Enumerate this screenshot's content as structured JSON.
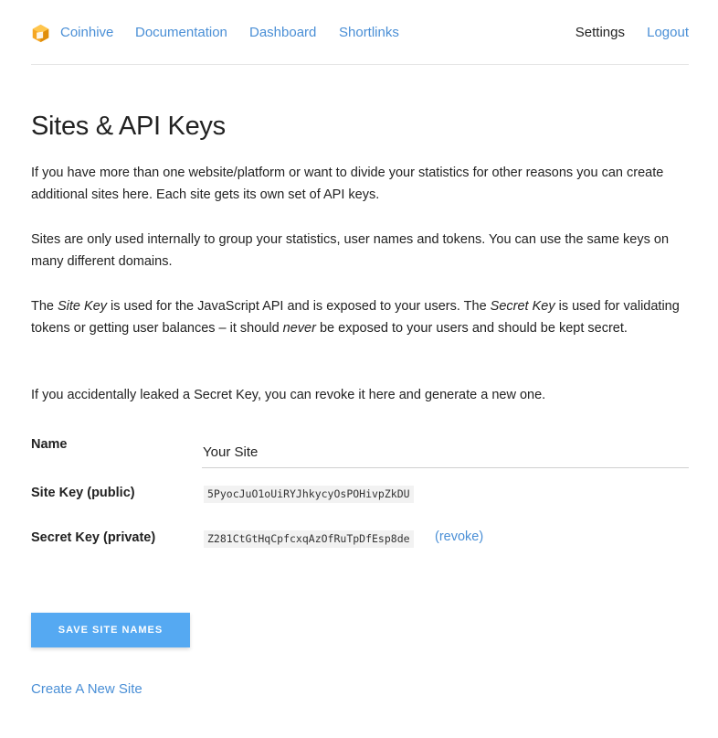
{
  "nav": {
    "logo_icon": "cube-logo-icon",
    "brand": "Coinhive",
    "links": [
      "Documentation",
      "Dashboard",
      "Shortlinks"
    ],
    "settings": "Settings",
    "logout": "Logout"
  },
  "page": {
    "title": "Sites & API Keys",
    "intro1": "If you have more than one website/platform or want to divide your statistics for other reasons you can create additional sites here. Each site gets its own set of API keys.",
    "intro2": "Sites are only used internally to group your statistics, user names and tokens. You can use the same keys on many different domains.",
    "intro3": {
      "a": "The ",
      "site_key": "Site Key",
      "b": " is used for the JavaScript API and is exposed to your users. The ",
      "secret_key": "Secret Key",
      "c": " is used for validating tokens or getting user balances – it should ",
      "never": "never",
      "d": " be exposed to your users and should be kept secret."
    },
    "intro4": "If you accidentally leaked a Secret Key, you can revoke it here and generate a new one."
  },
  "form": {
    "name_label": "Name",
    "name_value": "Your Site",
    "site_key_label": "Site Key (public)",
    "site_key": "5PyocJuO1oUiRYJhkycyOsPOHivpZkDU",
    "secret_key_label": "Secret Key (private)",
    "secret_key": "Z281CtGtHqCpfcxqAzOfRuTpDfEsp8de",
    "revoke": "(revoke)"
  },
  "actions": {
    "save": "SAVE SITE NAMES",
    "create": "Create A New Site"
  },
  "colors": {
    "link": "#4a8fd6",
    "button": "#55a9f2",
    "logo": "#f5a623"
  }
}
